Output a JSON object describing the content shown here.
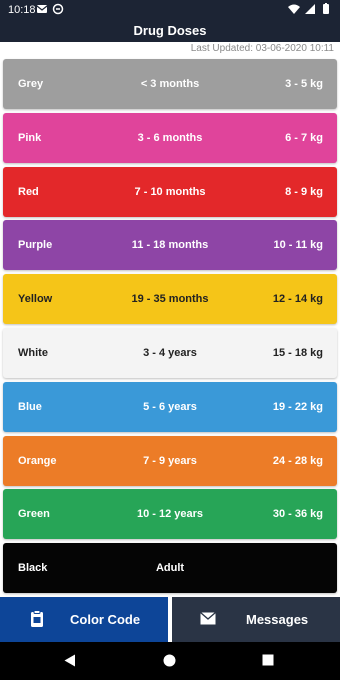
{
  "status_bar": {
    "time": "10:18"
  },
  "header": {
    "title": "Drug Doses",
    "last_updated": "Last Updated: 03-06-2020 10:11"
  },
  "rows": [
    {
      "name": "Grey",
      "age": "< 3 months",
      "weight": "3 - 5 kg",
      "bg": "#9e9e9e",
      "fg": "#ffffff"
    },
    {
      "name": "Pink",
      "age": "3 - 6 months",
      "weight": "6 - 7 kg",
      "bg": "#e0449b",
      "fg": "#ffffff"
    },
    {
      "name": "Red",
      "age": "7 - 10 months",
      "weight": "8 - 9 kg",
      "bg": "#e3282a",
      "fg": "#ffffff"
    },
    {
      "name": "Purple",
      "age": "11 - 18 months",
      "weight": "10 - 11 kg",
      "bg": "#8e45a6",
      "fg": "#ffffff"
    },
    {
      "name": "Yellow",
      "age": "19 - 35 months",
      "weight": "12 - 14 kg",
      "bg": "#f5c518",
      "fg": "#222222"
    },
    {
      "name": "White",
      "age": "3 - 4 years",
      "weight": "15 - 18 kg",
      "bg": "#f4f4f4",
      "fg": "#222222"
    },
    {
      "name": "Blue",
      "age": "5 - 6 years",
      "weight": "19 - 22 kg",
      "bg": "#3a99d8",
      "fg": "#ffffff"
    },
    {
      "name": "Orange",
      "age": "7 - 9 years",
      "weight": "24 - 28 kg",
      "bg": "#ec7c27",
      "fg": "#ffffff"
    },
    {
      "name": "Green",
      "age": "10 - 12 years",
      "weight": "30 - 36 kg",
      "bg": "#27a557",
      "fg": "#ffffff"
    },
    {
      "name": "Black",
      "age": "Adult",
      "weight": "",
      "bg": "#050505",
      "fg": "#ffffff"
    }
  ],
  "bottom_nav": {
    "color_code_label": "Color Code",
    "messages_label": "Messages",
    "color_code_icon": "clipboard-icon",
    "messages_icon": "envelope-icon"
  },
  "system_nav": {
    "back_icon": "back-triangle-icon",
    "home_icon": "home-circle-icon",
    "recents_icon": "recents-square-icon"
  }
}
